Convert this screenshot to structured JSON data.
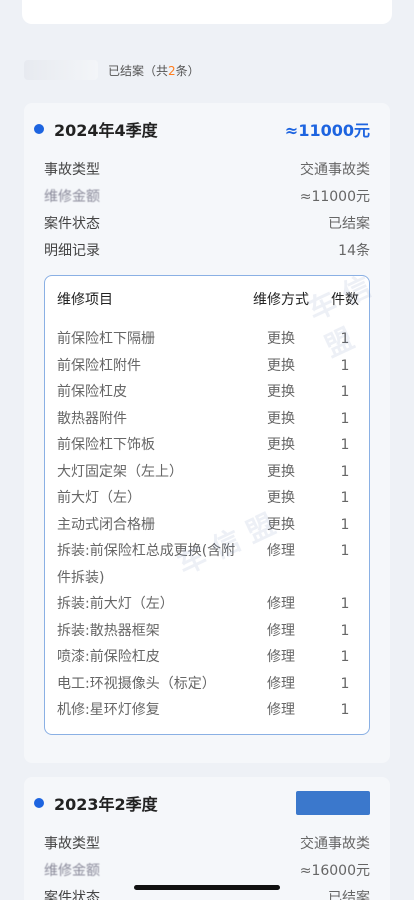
{
  "section": {
    "status_text": "已结案",
    "count_prefix": "（共",
    "count_value": "2",
    "count_suffix": "条）"
  },
  "records": [
    {
      "quarter": "2024年4季度",
      "amount": "≈11000元",
      "info": [
        {
          "label": "事故类型",
          "value": "交通事故类"
        },
        {
          "label": "维修金额",
          "value": "≈11000元"
        },
        {
          "label": "案件状态",
          "value": "已结案"
        },
        {
          "label": "明细记录",
          "value": "14条"
        }
      ],
      "detail": {
        "headers": {
          "item": "维修项目",
          "method": "维修方式",
          "count": "件数"
        },
        "rows": [
          {
            "item": "前保险杠下隔栅",
            "method": "更换",
            "count": "1"
          },
          {
            "item": "前保险杠附件",
            "method": "更换",
            "count": "1"
          },
          {
            "item": "前保险杠皮",
            "method": "更换",
            "count": "1"
          },
          {
            "item": "散热器附件",
            "method": "更换",
            "count": "1"
          },
          {
            "item": "前保险杠下饰板",
            "method": "更换",
            "count": "1"
          },
          {
            "item": "大灯固定架（左上）",
            "method": "更换",
            "count": "1"
          },
          {
            "item": "前大灯（左）",
            "method": "更换",
            "count": "1"
          },
          {
            "item": "主动式闭合格栅",
            "method": "更换",
            "count": "1"
          },
          {
            "item": "拆装:前保险杠总成更换(含附件拆装)",
            "method": "修理",
            "count": "1"
          },
          {
            "item": "拆装:前大灯（左）",
            "method": "修理",
            "count": "1"
          },
          {
            "item": "拆装:散热器框架",
            "method": "修理",
            "count": "1"
          },
          {
            "item": "喷漆:前保险杠皮",
            "method": "修理",
            "count": "1"
          },
          {
            "item": "电工:环视摄像头（标定）",
            "method": "修理",
            "count": "1"
          },
          {
            "item": "机修:星环灯修复",
            "method": "修理",
            "count": "1"
          }
        ]
      }
    },
    {
      "quarter": "2023年2季度",
      "info": [
        {
          "label": "事故类型",
          "value": "交通事故类"
        },
        {
          "label": "维修金额",
          "value": "≈16000元"
        },
        {
          "label": "案件状态",
          "value": "已结案"
        }
      ]
    }
  ],
  "watermark_text": "车 信 盟"
}
